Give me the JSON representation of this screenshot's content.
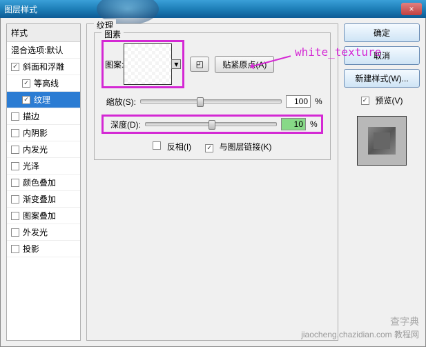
{
  "titlebar": {
    "title": "图层样式",
    "close": "×"
  },
  "left": {
    "header": "样式",
    "blend": "混合选项:默认",
    "items": [
      {
        "label": "斜面和浮雕",
        "checked": true,
        "selected": false,
        "indent": false
      },
      {
        "label": "等高线",
        "checked": true,
        "selected": false,
        "indent": true
      },
      {
        "label": "纹理",
        "checked": true,
        "selected": true,
        "indent": true
      },
      {
        "label": "描边",
        "checked": false,
        "selected": false,
        "indent": false
      },
      {
        "label": "内阴影",
        "checked": false,
        "selected": false,
        "indent": false
      },
      {
        "label": "内发光",
        "checked": false,
        "selected": false,
        "indent": false
      },
      {
        "label": "光泽",
        "checked": false,
        "selected": false,
        "indent": false
      },
      {
        "label": "颜色叠加",
        "checked": false,
        "selected": false,
        "indent": false
      },
      {
        "label": "渐变叠加",
        "checked": false,
        "selected": false,
        "indent": false
      },
      {
        "label": "图案叠加",
        "checked": false,
        "selected": false,
        "indent": false
      },
      {
        "label": "外发光",
        "checked": false,
        "selected": false,
        "indent": false
      },
      {
        "label": "投影",
        "checked": false,
        "selected": false,
        "indent": false
      }
    ]
  },
  "center": {
    "group": "纹理",
    "pattern_group": "图素",
    "pattern_label": "图案:",
    "snap_label": "贴紧原点(A)",
    "annotation": "white_texture",
    "scale": {
      "label": "缩放(S):",
      "value": "100",
      "pct": "%"
    },
    "depth": {
      "label": "深度(D):",
      "value": "10",
      "pct": "%"
    },
    "invert": "反相(I)",
    "link": "与图层链接(K)"
  },
  "right": {
    "ok": "确定",
    "cancel": "取消",
    "newstyle": "新建样式(W)...",
    "preview": "预览(V)"
  },
  "watermark": {
    "cn": "查字典",
    "en": "jiaocheng.chazidian.com",
    "sub": "教程网"
  }
}
